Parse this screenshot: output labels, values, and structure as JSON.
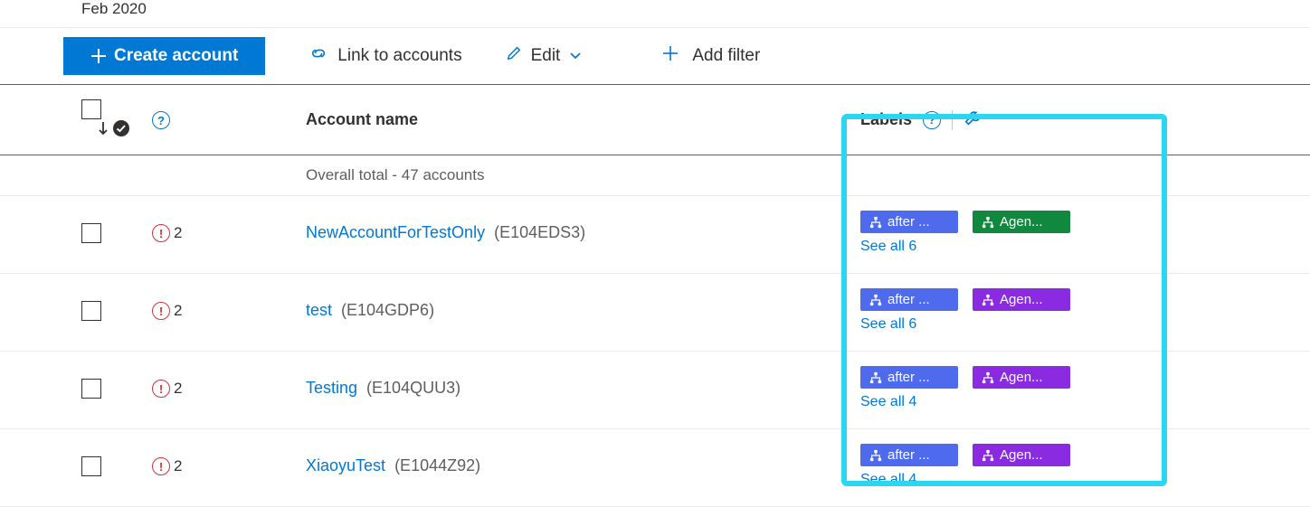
{
  "date_label": "Feb 2020",
  "toolbar": {
    "create": "Create account",
    "link": "Link to accounts",
    "edit": "Edit",
    "add_filter": "Add filter"
  },
  "columns": {
    "account_name": "Account name",
    "labels": "Labels"
  },
  "total_line": "Overall total - 47 accounts",
  "rows": [
    {
      "alert_count": "2",
      "name": "NewAccountForTestOnly",
      "id": "(E104EDS3)",
      "labels": [
        {
          "text": "after ...",
          "color": "blue"
        },
        {
          "text": "Agen...",
          "color": "green"
        }
      ],
      "see_all": "See all 6"
    },
    {
      "alert_count": "2",
      "name": "test",
      "id": "(E104GDP6)",
      "labels": [
        {
          "text": "after ...",
          "color": "blue"
        },
        {
          "text": "Agen...",
          "color": "purple"
        }
      ],
      "see_all": "See all 6"
    },
    {
      "alert_count": "2",
      "name": "Testing",
      "id": "(E104QUU3)",
      "labels": [
        {
          "text": "after ...",
          "color": "blue"
        },
        {
          "text": "Agen...",
          "color": "purple"
        }
      ],
      "see_all": "See all 4"
    },
    {
      "alert_count": "2",
      "name": "XiaoyuTest",
      "id": "(E1044Z92)",
      "labels": [
        {
          "text": "after ...",
          "color": "blue"
        },
        {
          "text": "Agen...",
          "color": "purple"
        }
      ],
      "see_all": "See all 4"
    }
  ]
}
